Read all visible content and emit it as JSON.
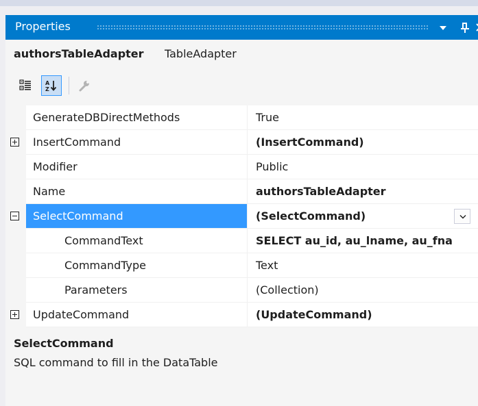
{
  "window": {
    "title": "Properties",
    "dropdown_icon": "triangle-down-icon",
    "pin_icon": "pin-icon",
    "close_icon": "close-icon"
  },
  "object_selector": {
    "name": "authorsTableAdapter",
    "type": "TableAdapter"
  },
  "toolbar": {
    "categorized_icon": "categorized-icon",
    "alphabetical_icon": "alphabetical-sort-icon",
    "property_pages_icon": "wrench-icon",
    "alphabetical_active": true
  },
  "properties": [
    {
      "name": "GenerateDBDirectMethods",
      "value": "True",
      "bold": false,
      "expander": "none",
      "indent": false
    },
    {
      "name": "InsertCommand",
      "value": "(InsertCommand)",
      "bold": true,
      "expander": "plus",
      "indent": false
    },
    {
      "name": "Modifier",
      "value": "Public",
      "bold": false,
      "expander": "none",
      "indent": false
    },
    {
      "name": "Name",
      "value": "authorsTableAdapter",
      "bold": true,
      "expander": "none",
      "indent": false
    },
    {
      "name": "SelectCommand",
      "value": "(SelectCommand)",
      "bold": true,
      "expander": "minus",
      "indent": false,
      "selected": true
    },
    {
      "name": "CommandText",
      "value": "SELECT au_id, au_lname, au_fna",
      "bold": true,
      "expander": "none",
      "indent": true
    },
    {
      "name": "CommandType",
      "value": "Text",
      "bold": false,
      "expander": "none",
      "indent": true
    },
    {
      "name": "Parameters",
      "value": "(Collection)",
      "bold": false,
      "expander": "none",
      "indent": true
    },
    {
      "name": "UpdateCommand",
      "value": "(UpdateCommand)",
      "bold": true,
      "expander": "plus",
      "indent": false
    }
  ],
  "description": {
    "title": "SelectCommand",
    "text": "SQL command to fill in the DataTable"
  },
  "colors": {
    "title_bar": "#007acc",
    "selection": "#3399ff",
    "panel": "#f5f5f5",
    "grid": "#ffffff"
  }
}
